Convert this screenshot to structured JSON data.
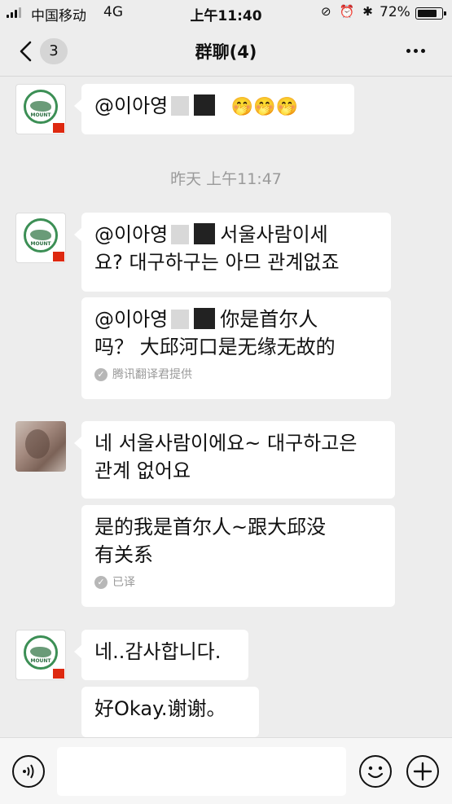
{
  "status_bar": {
    "carrier": "中国移动",
    "network": "4G",
    "time": "上午11:40",
    "battery": "72%",
    "battery_level": 0.72
  },
  "nav": {
    "unread_count": "3",
    "title": "群聊(4)"
  },
  "messages": {
    "m1": {
      "mention": "@이아영",
      "emoji": "🤭🤭🤭"
    },
    "timestamp": "昨天 上午11:47",
    "m2": {
      "mention": "@이아영",
      "line1": "서울사람이세",
      "line2": "요? 대구하구는 아므 관계없죠"
    },
    "m3": {
      "mention": "@이아영",
      "line1": "你是首尔人",
      "line2": "吗？ 大邱河口是无缘无故的",
      "note": "腾讯翻译君提供"
    },
    "m4": {
      "line1": "네 서울사람이에요~ 대구하고은",
      "line2": "관계 없어요"
    },
    "m5": {
      "line1": "是的我是首尔人~跟大邱没",
      "line2": "有关系",
      "note": "已译"
    },
    "m6": {
      "text": "네..감사합니다."
    },
    "m7": {
      "text": "好Okay.谢谢。"
    }
  },
  "icons": {
    "back": "chevron-left-icon",
    "more": "more-dots-icon",
    "voice": "voice-icon",
    "emoji": "emoji-icon",
    "plus": "plus-icon",
    "translated": "check-circle-icon"
  }
}
